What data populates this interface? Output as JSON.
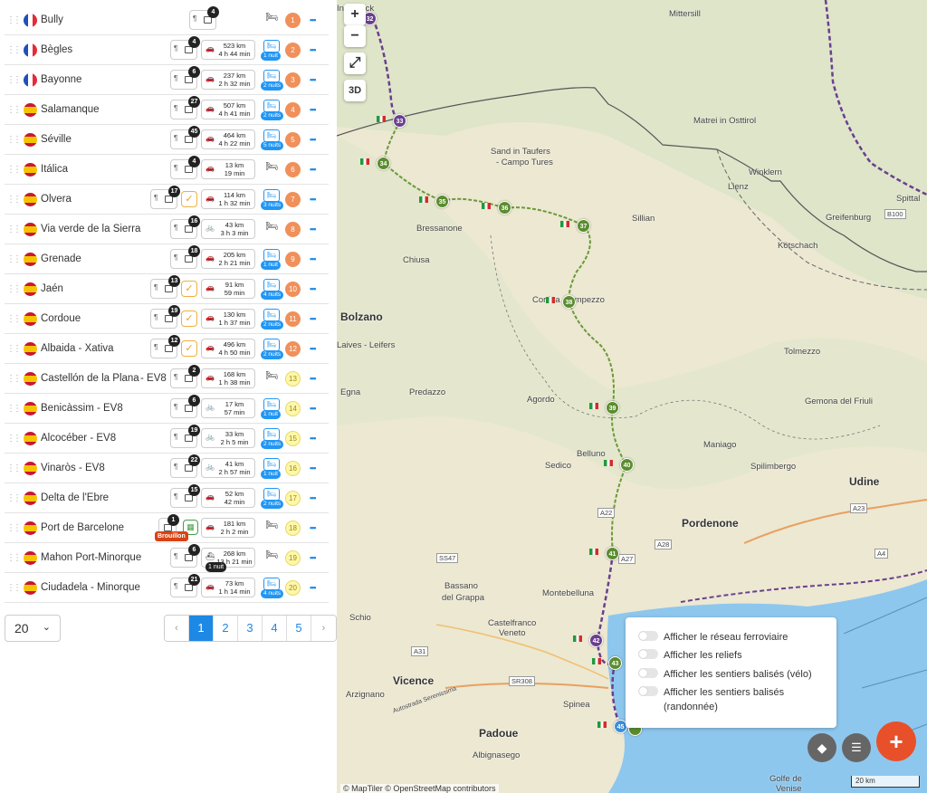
{
  "stages": [
    {
      "flag": "fr",
      "name": "Bully",
      "notes": "4",
      "transport": null,
      "bed": "off",
      "nights": "",
      "num": "1",
      "numStyle": "o"
    },
    {
      "flag": "fr",
      "name": "Bègles",
      "notes": "4",
      "transport": {
        "mode": "car",
        "km": "523 km",
        "time": "4 h 44 min"
      },
      "bed": "on",
      "nights": "1 nuit",
      "num": "2",
      "numStyle": "o"
    },
    {
      "flag": "fr",
      "name": "Bayonne",
      "notes": "6",
      "transport": {
        "mode": "car",
        "km": "237 km",
        "time": "2 h 32 min"
      },
      "bed": "on",
      "nights": "2 nuits",
      "num": "3",
      "numStyle": "o"
    },
    {
      "flag": "es",
      "name": "Salamanque",
      "notes": "27",
      "transport": {
        "mode": "car",
        "km": "507 km",
        "time": "4 h 41 min"
      },
      "bed": "on",
      "nights": "2 nuits",
      "num": "4",
      "numStyle": "o"
    },
    {
      "flag": "es",
      "name": "Séville",
      "notes": "45",
      "transport": {
        "mode": "car",
        "km": "464 km",
        "time": "4 h 22 min"
      },
      "bed": "on",
      "nights": "5 nuits",
      "num": "5",
      "numStyle": "o"
    },
    {
      "flag": "es",
      "name": "Itálica",
      "notes": "4",
      "transport": {
        "mode": "car",
        "km": "13 km",
        "time": "19 min"
      },
      "bed": "off",
      "nights": "",
      "num": "6",
      "numStyle": "o"
    },
    {
      "flag": "es",
      "name": "Olvera",
      "notes": "17",
      "check": true,
      "transport": {
        "mode": "car",
        "km": "114 km",
        "time": "1 h 32 min"
      },
      "bed": "on",
      "nights": "3 nuits",
      "num": "7",
      "numStyle": "o"
    },
    {
      "flag": "es",
      "name": "Via verde de la Sierra",
      "notes": "16",
      "transport": {
        "mode": "bike",
        "km": "43 km",
        "time": "3 h 3 min"
      },
      "bed": "off",
      "nights": "",
      "num": "8",
      "numStyle": "o"
    },
    {
      "flag": "es",
      "name": "Grenade",
      "notes": "18",
      "transport": {
        "mode": "car",
        "km": "205 km",
        "time": "2 h 21 min"
      },
      "bed": "on",
      "nights": "1 nuit",
      "num": "9",
      "numStyle": "o"
    },
    {
      "flag": "es",
      "name": "Jaén",
      "notes": "13",
      "check": true,
      "transport": {
        "mode": "car",
        "km": "91 km",
        "time": "59 min"
      },
      "bed": "on",
      "nights": "4 nuits",
      "num": "10",
      "numStyle": "o"
    },
    {
      "flag": "es",
      "name": "Cordoue",
      "notes": "19",
      "check": true,
      "transport": {
        "mode": "car",
        "km": "130 km",
        "time": "1 h 37 min"
      },
      "bed": "on",
      "nights": "2 nuits",
      "num": "11",
      "numStyle": "o"
    },
    {
      "flag": "es",
      "name": "Albaida - Xativa",
      "notes": "12",
      "check": true,
      "transport": {
        "mode": "car",
        "km": "496 km",
        "time": "4 h 50 min"
      },
      "bed": "on",
      "nights": "2 nuits",
      "num": "12",
      "numStyle": "o"
    },
    {
      "flag": "es",
      "name": "Castellón de la Plana",
      "sub": " - EV8",
      "notes": "2",
      "transport": {
        "mode": "car",
        "km": "168 km",
        "time": "1 h 38 min"
      },
      "bed": "off",
      "nights": "",
      "num": "13",
      "numStyle": "y"
    },
    {
      "flag": "es",
      "name": "Benicàssim - EV8",
      "notes": "6",
      "transport": {
        "mode": "bike",
        "km": "17 km",
        "time": "57 min"
      },
      "bed": "on",
      "nights": "1 nuit",
      "num": "14",
      "numStyle": "y"
    },
    {
      "flag": "es",
      "name": "Alcocéber - EV8",
      "notes": "19",
      "transport": {
        "mode": "bike",
        "km": "33 km",
        "time": "2 h 5 min"
      },
      "bed": "on",
      "nights": "2 nuits",
      "num": "15",
      "numStyle": "y"
    },
    {
      "flag": "es",
      "name": "Vinaròs - EV8",
      "notes": "22",
      "transport": {
        "mode": "bike",
        "km": "41 km",
        "time": "2 h 57 min"
      },
      "bed": "on",
      "nights": "1 nuit",
      "num": "16",
      "numStyle": "y"
    },
    {
      "flag": "es",
      "name": "Delta de l'Ebre",
      "notes": "15",
      "transport": {
        "mode": "car",
        "km": "52 km",
        "time": "42 min"
      },
      "bed": "on",
      "nights": "2 nuits",
      "num": "17",
      "numStyle": "y"
    },
    {
      "flag": "es",
      "name": "Port de Barcelone",
      "notes": "1",
      "draft": "Brouillon",
      "calendar": true,
      "transport": {
        "mode": "car",
        "km": "181 km",
        "time": "2 h 2 min"
      },
      "bed": "off",
      "nights": "",
      "num": "18",
      "numStyle": "y"
    },
    {
      "flag": "es",
      "name": "Mahon Port-Minorque",
      "notes": "6",
      "transport": {
        "mode": "ferry",
        "km": "268 km",
        "time": "13 h 21 min",
        "pill": "1 nuit"
      },
      "bed": "off",
      "nights": "",
      "num": "19",
      "numStyle": "y"
    },
    {
      "flag": "es",
      "name": "Ciudadela - Minorque",
      "notes": "21",
      "transport": {
        "mode": "car",
        "km": "73 km",
        "time": "1 h 14 min"
      },
      "bed": "on",
      "nights": "4 nuits",
      "num": "20",
      "numStyle": "y"
    }
  ],
  "pagination": {
    "per_page": "20",
    "prev": "‹",
    "next": "›",
    "pages": [
      "1",
      "2",
      "3",
      "4",
      "5"
    ],
    "active": "1"
  },
  "map": {
    "controls": {
      "zoom_in": "+",
      "zoom_out": "−",
      "fullscreen": "⤢",
      "three_d": "3D"
    },
    "places": [
      {
        "t": "Mittersill"
      },
      {
        "t": "Matrei in Osttirol"
      },
      {
        "t": "Sand in Taufers"
      },
      {
        "t": "- Campo Tures"
      },
      {
        "t": "Winklern"
      },
      {
        "t": "Lienz"
      },
      {
        "t": "Spittal"
      },
      {
        "t": "Greifenburg"
      },
      {
        "t": "B100"
      },
      {
        "t": "Sillian"
      },
      {
        "t": "Kötschach"
      },
      {
        "t": "Bressanone"
      },
      {
        "t": "Chiusa"
      },
      {
        "t": "Cortina d'Ampezzo"
      },
      {
        "t": "Bolzano",
        "big": true
      },
      {
        "t": "Laives - Leifers"
      },
      {
        "t": "Egna"
      },
      {
        "t": "Predazzo"
      },
      {
        "t": "Agordo"
      },
      {
        "t": "Tolmezzo"
      },
      {
        "t": "Gemona del Friuli"
      },
      {
        "t": "Maniago"
      },
      {
        "t": "Belluno"
      },
      {
        "t": "Sedico"
      },
      {
        "t": "Spilimbergo"
      },
      {
        "t": "Udine",
        "big": true
      },
      {
        "t": "A23"
      },
      {
        "t": "Pordenone",
        "big": true
      },
      {
        "t": "A22"
      },
      {
        "t": "A28"
      },
      {
        "t": "A4"
      },
      {
        "t": "SS47"
      },
      {
        "t": "A27"
      },
      {
        "t": "Bassano"
      },
      {
        "t": "del Grappa"
      },
      {
        "t": "Montebelluna"
      },
      {
        "t": "Schio"
      },
      {
        "t": "Castelfranco"
      },
      {
        "t": "Veneto"
      },
      {
        "t": "A31"
      },
      {
        "t": "Vicence",
        "big": true
      },
      {
        "t": "SR308"
      },
      {
        "t": "Arzignano"
      },
      {
        "t": "Spinea"
      },
      {
        "t": "Padoue",
        "big": true
      },
      {
        "t": "Albignasego"
      },
      {
        "t": "Golfe de"
      },
      {
        "t": "Venise"
      },
      {
        "t": "Autostrada Serenissima"
      },
      {
        "t": "Innsbruck"
      }
    ],
    "markers": [
      {
        "n": "32",
        "c": "p"
      },
      {
        "n": "33",
        "c": "p"
      },
      {
        "n": "34",
        "c": "g"
      },
      {
        "n": "35",
        "c": "g"
      },
      {
        "n": "36",
        "c": "g"
      },
      {
        "n": "37",
        "c": "g"
      },
      {
        "n": "38",
        "c": "g"
      },
      {
        "n": "39",
        "c": "g"
      },
      {
        "n": "40",
        "c": "g"
      },
      {
        "n": "41",
        "c": "g"
      },
      {
        "n": "42",
        "c": "p"
      },
      {
        "n": "43",
        "c": "g"
      },
      {
        "n": "45",
        "c": "b"
      },
      {
        "n": "",
        "c": "g"
      }
    ],
    "layers": [
      {
        "label": "Afficher le réseau ferroviaire"
      },
      {
        "label": "Afficher les reliefs"
      },
      {
        "label": "Afficher les sentiers balisés (vélo)"
      },
      {
        "label": "Afficher les sentiers balisés (randonnée)"
      }
    ],
    "attribution": "© MapTiler © OpenStreetMap contributors",
    "scale": "20 km",
    "colors": {
      "route_green": "#6a9a3a",
      "route_purple": "#6a3f8e",
      "sea": "#8ec7ee",
      "fab_red": "#e8502a"
    }
  }
}
